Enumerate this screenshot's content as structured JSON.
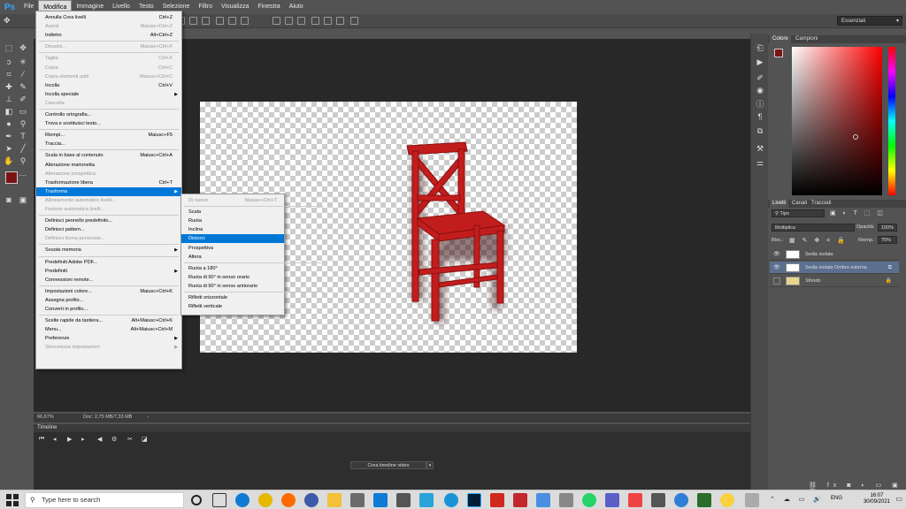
{
  "app": {
    "logo": "Ps"
  },
  "menubar": [
    "File",
    "Modifica",
    "Immagine",
    "Livello",
    "Testo",
    "Selezione",
    "Filtro",
    "Visualizza",
    "Finestra",
    "Aiuto"
  ],
  "workspace": "Essenziali",
  "status": {
    "zoom": "66,67%",
    "doc": "Doc: 2,75 MB/7,33 MB"
  },
  "edit_menu": [
    {
      "label": "Annulla Crea livelli",
      "sc": "Ctrl+Z"
    },
    {
      "label": "Avanti",
      "sc": "Maiusc+Ctrl+Z",
      "dis": true
    },
    {
      "label": "Indietro",
      "sc": "Alt+Ctrl+Z"
    },
    {
      "sep": true
    },
    {
      "label": "Dissolvi...",
      "sc": "Maiusc+Ctrl+F",
      "dis": true
    },
    {
      "sep": true
    },
    {
      "label": "Taglia",
      "sc": "Ctrl+X",
      "dis": true
    },
    {
      "label": "Copia",
      "sc": "Ctrl+C",
      "dis": true
    },
    {
      "label": "Copia elementi uniti",
      "sc": "Maiusc+Ctrl+C",
      "dis": true
    },
    {
      "label": "Incolla",
      "sc": "Ctrl+V"
    },
    {
      "label": "Incolla speciale",
      "sub": true
    },
    {
      "label": "Cancella",
      "dis": true
    },
    {
      "sep": true
    },
    {
      "label": "Controllo ortografia..."
    },
    {
      "label": "Trova e sostituisci testo..."
    },
    {
      "sep": true
    },
    {
      "label": "Riempi...",
      "sc": "Maiusc+F5"
    },
    {
      "label": "Traccia..."
    },
    {
      "sep": true
    },
    {
      "label": "Scala in base al contenuto",
      "sc": "Maiusc+Ctrl+A"
    },
    {
      "label": "Alterazione marionetta"
    },
    {
      "label": "Alterazione prospettica",
      "dis": true
    },
    {
      "label": "Trasformazione libera",
      "sc": "Ctrl+T"
    },
    {
      "label": "Trasforma",
      "sub": true,
      "sel": true
    },
    {
      "label": "Allineamento automatico livelli...",
      "dis": true
    },
    {
      "label": "Fusione automatica livelli...",
      "dis": true
    },
    {
      "sep": true
    },
    {
      "label": "Definisci pennello predefinito..."
    },
    {
      "label": "Definisci pattern..."
    },
    {
      "label": "Definisci forma personale...",
      "dis": true
    },
    {
      "sep": true
    },
    {
      "label": "Svuota memoria",
      "sub": true
    },
    {
      "sep": true
    },
    {
      "label": "Predefiniti Adobe PDF..."
    },
    {
      "label": "Predefiniti",
      "sub": true
    },
    {
      "label": "Connessioni remote..."
    },
    {
      "sep": true
    },
    {
      "label": "Impostazioni colore...",
      "sc": "Maiusc+Ctrl+K"
    },
    {
      "label": "Assegna profilo..."
    },
    {
      "label": "Converti in profilo..."
    },
    {
      "sep": true
    },
    {
      "label": "Scelte rapide da tastiera...",
      "sc": "Alt+Maiusc+Ctrl+K"
    },
    {
      "label": "Menu...",
      "sc": "Alt+Maiusc+Ctrl+M"
    },
    {
      "label": "Preferenze",
      "sub": true
    },
    {
      "label": "Sincronizza impostazioni",
      "sub": true,
      "dis": true
    }
  ],
  "transform_menu": [
    {
      "label": "Di nuovo",
      "sc": "Maiusc+Ctrl+T",
      "dis": true
    },
    {
      "sep": true
    },
    {
      "label": "Scala"
    },
    {
      "label": "Ruota"
    },
    {
      "label": "Inclina"
    },
    {
      "label": "Distorci",
      "sel": true
    },
    {
      "label": "Prospettiva"
    },
    {
      "label": "Altera"
    },
    {
      "sep": true
    },
    {
      "label": "Ruota a 180°"
    },
    {
      "label": "Ruota di 90° in senso orario"
    },
    {
      "label": "Ruota di 90° in senso antiorario"
    },
    {
      "sep": true
    },
    {
      "label": "Rifletti orizzontale"
    },
    {
      "label": "Rifletti verticale"
    }
  ],
  "panels": {
    "color_tabs": [
      "Colore",
      "Campioni"
    ],
    "layer_tabs": [
      "Livelli",
      "Canali",
      "Tracciati"
    ],
    "filter": "Tipo",
    "blend_mode": "Moltiplica",
    "opacity_label": "Opacità:",
    "opacity": "100%",
    "lock_label": "Bloc.:",
    "fill_label": "Riemp.:",
    "fill": "75%",
    "fg_color": "#7a1414"
  },
  "layers": [
    {
      "name": "Sedia isolata"
    },
    {
      "name": "Sedia isolata Ombra esterna",
      "sel": true
    },
    {
      "name": "Sfondo",
      "lock": true
    }
  ],
  "timeline": {
    "title": "Timeline",
    "create_label": "Crea timeline video"
  },
  "taskbar": {
    "search_placeholder": "Type here to search",
    "lang": "ENG",
    "time": "16:07",
    "date": "30/09/2021"
  }
}
